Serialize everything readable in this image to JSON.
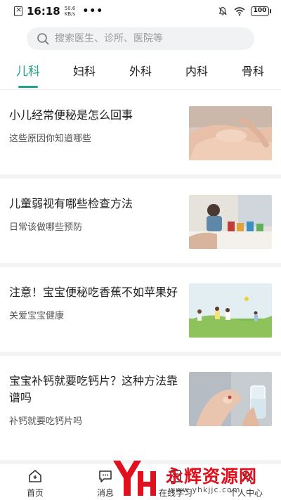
{
  "status_bar": {
    "time": "16:18",
    "net_speed_value": "50.6",
    "net_speed_unit": "KB/s",
    "dots": "•••",
    "battery": "100"
  },
  "search": {
    "placeholder": "搜索医生、诊所、医院等"
  },
  "tabs": [
    {
      "label": "儿科",
      "active": true
    },
    {
      "label": "妇科",
      "active": false
    },
    {
      "label": "外科",
      "active": false
    },
    {
      "label": "内科",
      "active": false
    },
    {
      "label": "骨科",
      "active": false
    }
  ],
  "articles": [
    {
      "title": "小儿经常便秘是怎么回事",
      "subtitle": "这些原因你知道哪些"
    },
    {
      "title": "儿童弱视有哪些检查方法",
      "subtitle": "日常该做哪些预防"
    },
    {
      "title": "注意！宝宝便秘吃香蕉不如苹果好",
      "subtitle": "关爱宝宝健康"
    },
    {
      "title": "宝宝补钙就要吃钙片？这种方法靠谱吗",
      "subtitle": "补钙就要吃钙片吗"
    }
  ],
  "bottom_nav": [
    {
      "label": "首页",
      "icon": "home-icon"
    },
    {
      "label": "消息",
      "icon": "message-icon"
    },
    {
      "label": "在线学习",
      "icon": "study-icon"
    },
    {
      "label": "个人中心",
      "icon": "profile-icon"
    }
  ],
  "watermark": {
    "text": "永辉资源网",
    "url": "www.yhkjjc.com"
  },
  "colors": {
    "accent": "#21a588",
    "watermark": "#e0101e"
  }
}
